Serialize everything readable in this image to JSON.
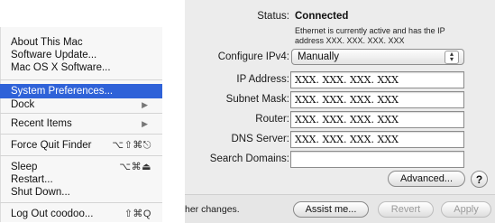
{
  "menu": {
    "items": [
      {
        "label": "About This Mac"
      },
      {
        "label": "Software Update..."
      },
      {
        "label": "Mac OS X Software..."
      },
      {
        "label": "System Preferences..."
      },
      {
        "label": "Dock",
        "submenu": true
      },
      {
        "label": "Recent Items",
        "submenu": true
      },
      {
        "label": "Force Quit Finder",
        "shortcut": "⌥⇧⌘⎋"
      },
      {
        "label": "Sleep",
        "shortcut": "⌥⌘⏏"
      },
      {
        "label": "Restart..."
      },
      {
        "label": "Shut Down..."
      },
      {
        "label": "Log Out coodoo...",
        "shortcut": "⇧⌘Q"
      }
    ],
    "selected_color": "#2f62d8"
  },
  "network": {
    "status_label": "Status:",
    "status_value": "Connected",
    "status_desc_1": "Ethernet is currently active and has the IP",
    "status_desc_2": "address XXX. XXX. XXX. XXX",
    "configure_label": "Configure IPv4:",
    "configure_value": "Manually",
    "ip_label": "IP Address:",
    "ip_value": "XXX. XXX. XXX. XXX",
    "subnet_label": "Subnet Mask:",
    "subnet_value": "XXX. XXX. XXX. XXX",
    "router_label": "Router:",
    "router_value": "XXX. XXX. XXX. XXX",
    "dns_label": "DNS Server:",
    "dns_value": "XXX. XXX. XXX. XXX",
    "search_label": "Search Domains:",
    "search_value": "",
    "advanced_label": "Advanced...",
    "help_label": "?",
    "footer_text": "her changes.",
    "assist_label": "Assist me...",
    "revert_label": "Revert",
    "apply_label": "Apply"
  }
}
